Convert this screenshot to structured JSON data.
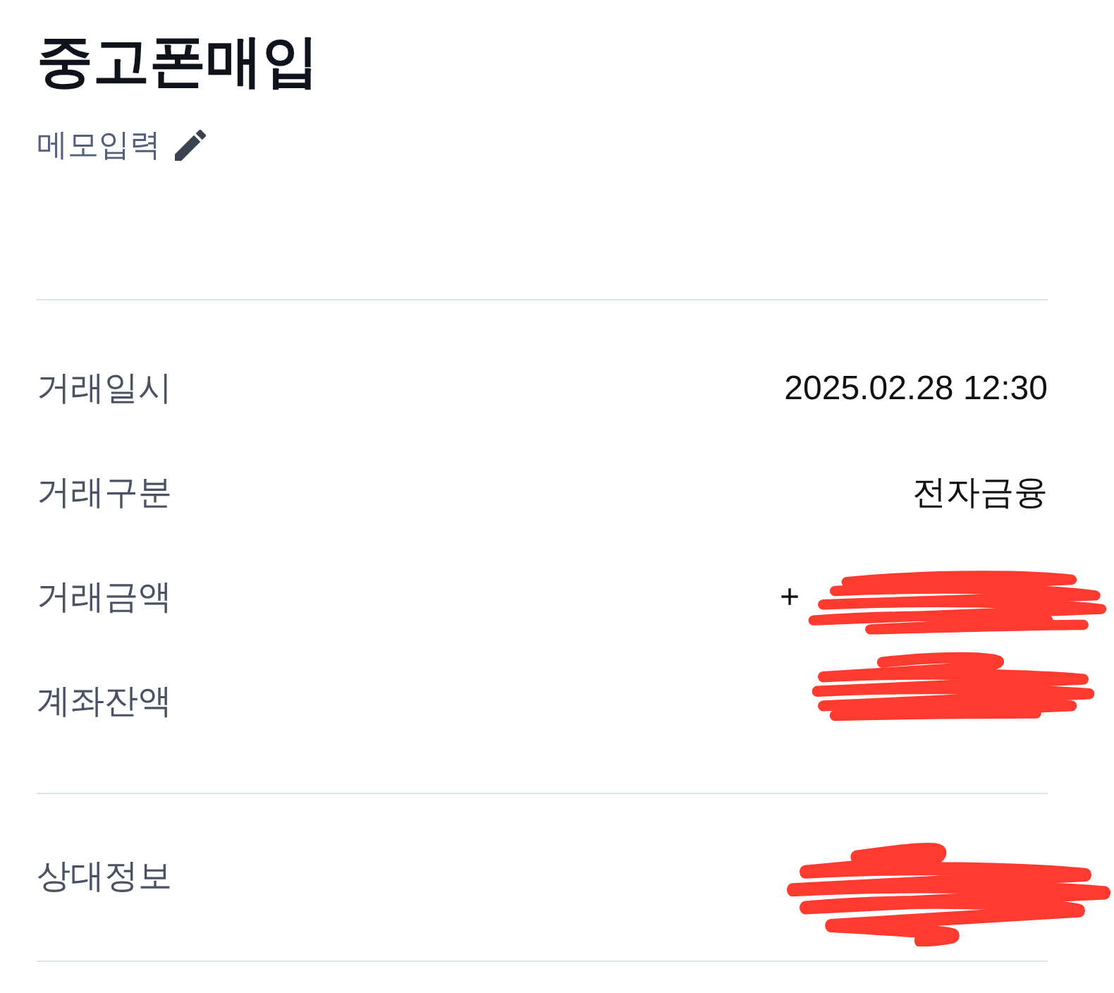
{
  "header": {
    "title": "중고폰매입",
    "memo_button": {
      "label": "메모입력"
    }
  },
  "details": [
    {
      "label": "거래일시",
      "value": "2025.02.28 12:30"
    },
    {
      "label": "거래구분",
      "value": "전자금융"
    },
    {
      "label": "거래금액",
      "value": "+",
      "redacted": true
    },
    {
      "label": "계좌잔액",
      "redacted": true
    }
  ],
  "counterpart": [
    {
      "label": "상대정보",
      "redacted": true
    }
  ]
}
